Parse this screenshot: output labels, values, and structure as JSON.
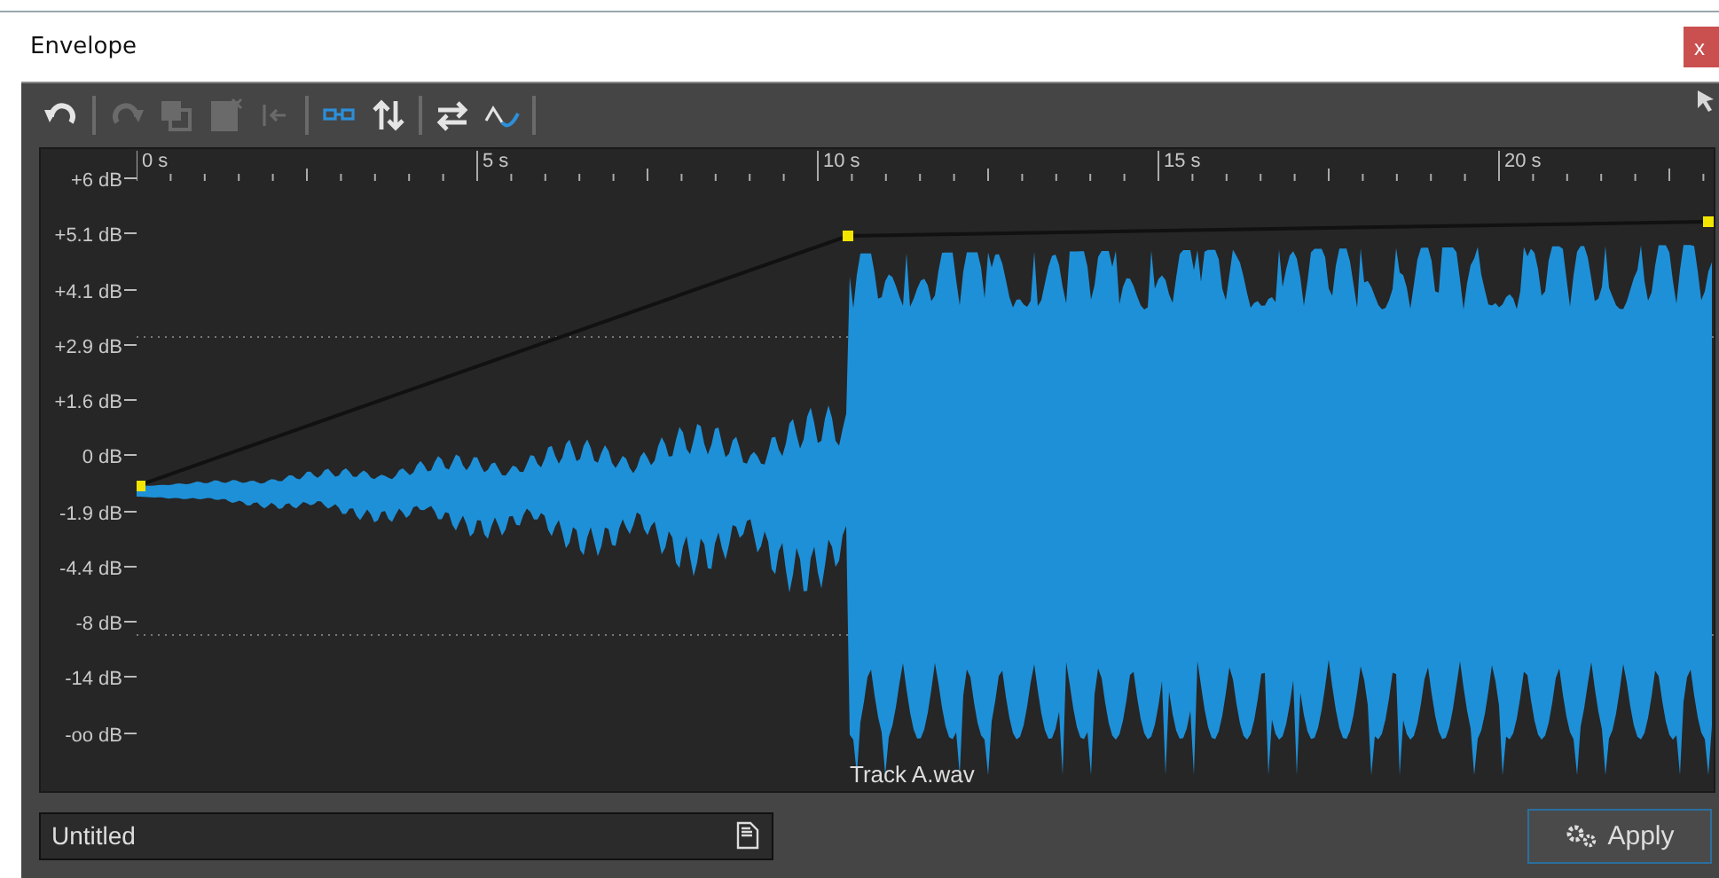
{
  "window": {
    "title": "Envelope",
    "close": "x"
  },
  "toolbar": [
    {
      "disabled": false
    },
    {
      "disabled": true
    },
    {
      "disabled": true
    },
    {
      "disabled": true
    },
    {
      "disabled": true
    },
    {
      "disabled": false
    },
    {
      "disabled": false
    },
    {
      "disabled": false
    },
    {
      "disabled": false
    }
  ],
  "ruler": {
    "labels": [
      "0 s",
      "5 s",
      "10 s",
      "15 s",
      "20 s"
    ]
  },
  "gain_axis": {
    "labels": [
      "+6 dB",
      "+5.1 dB",
      "+4.1 dB",
      "+2.9 dB",
      "+1.6 dB",
      "0 dB",
      "-1.9 dB",
      "-4.4 dB",
      "-8 dB",
      "-14 dB",
      "-oo dB"
    ]
  },
  "track": {
    "name": "Track A.wav"
  },
  "preset_field": {
    "value": "Untitled"
  },
  "apply_button": {
    "label": "Apply"
  }
}
